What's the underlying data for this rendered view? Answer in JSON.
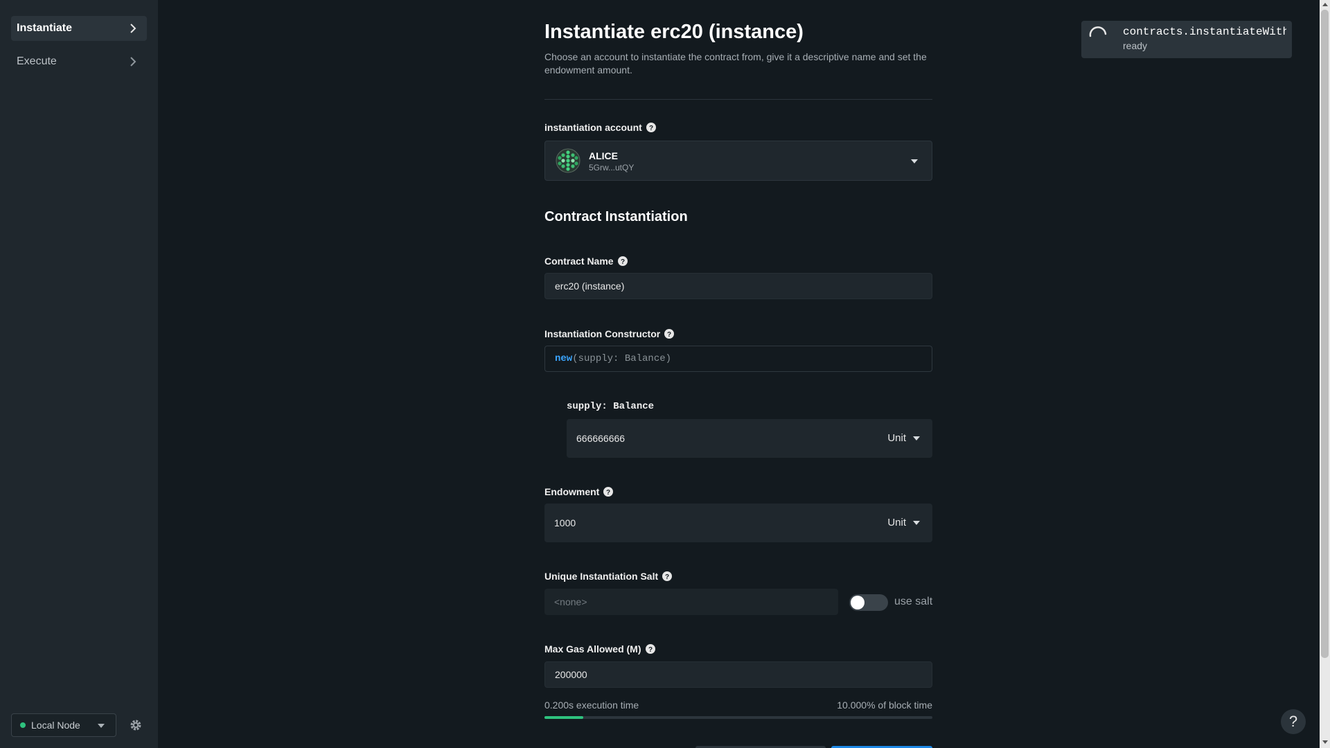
{
  "sidebar": {
    "items": [
      {
        "label": "Instantiate",
        "active": true
      },
      {
        "label": "Execute",
        "active": false
      }
    ],
    "node": {
      "label": "Local Node",
      "status_color": "#2ec27e"
    },
    "settings_icon": "gear-icon"
  },
  "main": {
    "title": "Instantiate erc20 (instance)",
    "subtitle": "Choose an account to instantiate the contract from, give it a descriptive name and set the endowment amount.",
    "account": {
      "label": "instantiation account",
      "name": "ALICE",
      "address": "5Grw...utQY"
    },
    "section_heading": "Contract Instantiation",
    "contract_name": {
      "label": "Contract Name",
      "value": "erc20 (instance)"
    },
    "constructor": {
      "label": "Instantiation Constructor",
      "keyword": "new",
      "args": "(supply: Balance)",
      "param": {
        "label": "supply: Balance",
        "value": "666666666",
        "unit": "Unit"
      }
    },
    "endowment": {
      "label": "Endowment",
      "value": "1000",
      "unit": "Unit"
    },
    "salt": {
      "label": "Unique Instantiation Salt",
      "placeholder": "<none>",
      "toggle_label": "use salt",
      "enabled": false
    },
    "gas": {
      "label": "Max Gas Allowed (M)",
      "value": "200000",
      "execution_time": "0.200s execution time",
      "block_time": "10.000% of block time",
      "fill_percent": 10
    }
  },
  "toast": {
    "method": "contracts.instantiateWithCode",
    "status": "ready"
  },
  "help_button": "?",
  "colors": {
    "accent": "#2ec27e",
    "primary_button": "#1e88e5",
    "background": "#131a1f",
    "surface": "#1f272d"
  }
}
